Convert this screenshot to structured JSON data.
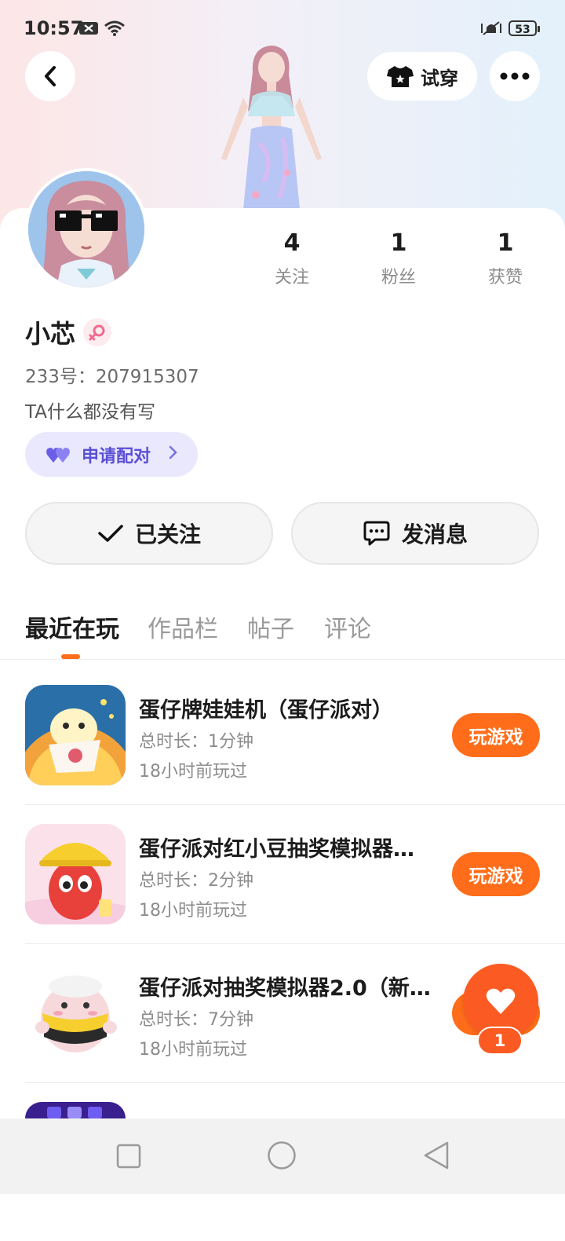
{
  "status_bar": {
    "time": "10:57",
    "battery": "53"
  },
  "header": {
    "try_on_label": "试穿"
  },
  "profile": {
    "name": "小芯",
    "uid": "233号：207915307",
    "bio": "TA什么都没有写",
    "pair_label": "申请配对",
    "stats": [
      {
        "value": "4",
        "label": "关注"
      },
      {
        "value": "1",
        "label": "粉丝"
      },
      {
        "value": "1",
        "label": "获赞"
      }
    ]
  },
  "actions": {
    "follow_label": "已关注",
    "message_label": "发消息"
  },
  "tabs": [
    {
      "label": "最近在玩"
    },
    {
      "label": "作品栏"
    },
    {
      "label": "帖子"
    },
    {
      "label": "评论"
    }
  ],
  "games": [
    {
      "title": "蛋仔牌娃娃机（蛋仔派对）",
      "duration": "总时长：1分钟",
      "last_played": "18小时前玩过",
      "button": "玩游戏"
    },
    {
      "title": " 蛋仔派对红小豆抽奖模拟器…",
      "duration": "总时长：2分钟",
      "last_played": "18小时前玩过",
      "button": "玩游戏"
    },
    {
      "title": "蛋仔派对抽奖模拟器2.0（新…",
      "duration": "总时长：7分钟",
      "last_played": "18小时前玩过",
      "button": "玩游戏"
    }
  ],
  "like": {
    "count": "1"
  },
  "colors": {
    "accent": "#ff6d1a",
    "pair_bg": "#eae8fd",
    "pair_text": "#5b4fd6"
  }
}
